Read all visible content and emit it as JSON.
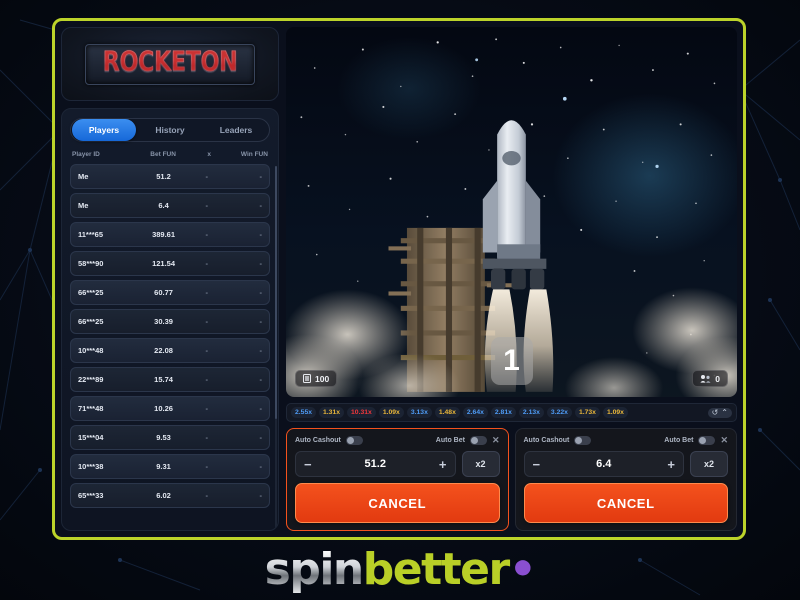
{
  "brand": {
    "logo": "ROCKETON",
    "footer_spin": "spin",
    "footer_better": "better",
    "footer_dot": "•",
    "frame_color": "#bcd32a"
  },
  "sidebar": {
    "tabs": [
      {
        "label": "Players",
        "active": true
      },
      {
        "label": "History",
        "active": false
      },
      {
        "label": "Leaders",
        "active": false
      }
    ],
    "columns": {
      "player_id": "Player ID",
      "bet": "Bet FUN",
      "multiplier": "x",
      "win": "Win FUN"
    },
    "rows": [
      {
        "player": "Me",
        "bet": "51.2",
        "x": "-",
        "win": "-"
      },
      {
        "player": "Me",
        "bet": "6.4",
        "x": "-",
        "win": "-"
      },
      {
        "player": "11***65",
        "bet": "389.61",
        "x": "-",
        "win": "-"
      },
      {
        "player": "58***90",
        "bet": "121.54",
        "x": "-",
        "win": "-"
      },
      {
        "player": "66***25",
        "bet": "60.77",
        "x": "-",
        "win": "-"
      },
      {
        "player": "66***25",
        "bet": "30.39",
        "x": "-",
        "win": "-"
      },
      {
        "player": "10***48",
        "bet": "22.08",
        "x": "-",
        "win": "-"
      },
      {
        "player": "22***89",
        "bet": "15.74",
        "x": "-",
        "win": "-"
      },
      {
        "player": "71***48",
        "bet": "10.26",
        "x": "-",
        "win": "-"
      },
      {
        "player": "15***04",
        "bet": "9.53",
        "x": "-",
        "win": "-"
      },
      {
        "player": "10***38",
        "bet": "9.31",
        "x": "-",
        "win": "-"
      },
      {
        "player": "65***33",
        "bet": "6.02",
        "x": "-",
        "win": "-"
      }
    ]
  },
  "stage": {
    "countdown": "1",
    "balance_badge": "100",
    "players_badge": "0"
  },
  "history": {
    "chips": [
      {
        "value": "2.55x",
        "color": "blue"
      },
      {
        "value": "1.31x",
        "color": "yellow"
      },
      {
        "value": "10.31x",
        "color": "red"
      },
      {
        "value": "1.09x",
        "color": "yellow"
      },
      {
        "value": "3.13x",
        "color": "blue"
      },
      {
        "value": "1.48x",
        "color": "yellow"
      },
      {
        "value": "2.64x",
        "color": "blue"
      },
      {
        "value": "2.81x",
        "color": "blue"
      },
      {
        "value": "2.13x",
        "color": "blue"
      },
      {
        "value": "3.22x",
        "color": "blue"
      },
      {
        "value": "1.73x",
        "color": "yellow"
      },
      {
        "value": "1.09x",
        "color": "yellow"
      }
    ],
    "history_icon": "↺",
    "expand_icon": "⌃"
  },
  "bets": [
    {
      "auto_cashout_label": "Auto Cashout",
      "auto_bet_label": "Auto Bet",
      "close_label": "✕",
      "minus": "−",
      "plus": "+",
      "amount": "51.2",
      "multiply_label": "x2",
      "action_label": "CANCEL"
    },
    {
      "auto_cashout_label": "Auto Cashout",
      "auto_bet_label": "Auto Bet",
      "close_label": "✕",
      "minus": "−",
      "plus": "+",
      "amount": "6.4",
      "multiply_label": "x2",
      "action_label": "CANCEL"
    }
  ]
}
